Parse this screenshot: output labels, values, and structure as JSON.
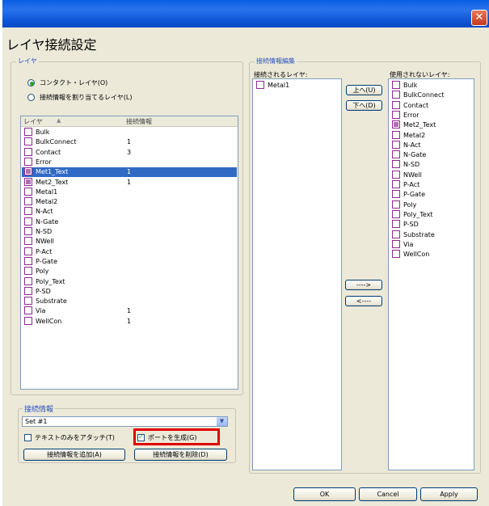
{
  "window": {
    "close_glyph": "✕",
    "title": "レイヤ接続設定"
  },
  "layer_group": {
    "label": "レイヤ",
    "radio_contact_layer": "コンタクト・レイヤ(O)",
    "radio_assign_connection": "接続情報を割り当てるレイヤ(L)",
    "col_layer": "レイヤ",
    "col_sort_glyph": "▲",
    "col_connection": "接続情報",
    "rows": [
      {
        "name": "Bulk",
        "value": "",
        "checked": false,
        "selected": false
      },
      {
        "name": "BulkConnect",
        "value": "1",
        "checked": false,
        "selected": false
      },
      {
        "name": "Contact",
        "value": "3",
        "checked": false,
        "selected": false
      },
      {
        "name": "Error",
        "value": "",
        "checked": false,
        "selected": false
      },
      {
        "name": "Met1_Text",
        "value": "1",
        "checked": true,
        "selected": true
      },
      {
        "name": "Met2_Text",
        "value": "1",
        "checked": true,
        "selected": false
      },
      {
        "name": "Metal1",
        "value": "",
        "checked": false,
        "selected": false
      },
      {
        "name": "Metal2",
        "value": "",
        "checked": false,
        "selected": false
      },
      {
        "name": "N-Act",
        "value": "",
        "checked": false,
        "selected": false
      },
      {
        "name": "N-Gate",
        "value": "",
        "checked": false,
        "selected": false
      },
      {
        "name": "N-SD",
        "value": "",
        "checked": false,
        "selected": false
      },
      {
        "name": "NWell",
        "value": "",
        "checked": false,
        "selected": false
      },
      {
        "name": "P-Act",
        "value": "",
        "checked": false,
        "selected": false
      },
      {
        "name": "P-Gate",
        "value": "",
        "checked": false,
        "selected": false
      },
      {
        "name": "Poly",
        "value": "",
        "checked": false,
        "selected": false
      },
      {
        "name": "Poly_Text",
        "value": "",
        "checked": false,
        "selected": false
      },
      {
        "name": "P-SD",
        "value": "",
        "checked": false,
        "selected": false
      },
      {
        "name": "Substrate",
        "value": "",
        "checked": false,
        "selected": false
      },
      {
        "name": "Via",
        "value": "1",
        "checked": false,
        "selected": false
      },
      {
        "name": "WellCon",
        "value": "1",
        "checked": false,
        "selected": false
      }
    ]
  },
  "conn_group": {
    "label": "接続情報",
    "select_value": "Set #1",
    "attach_text_only": "テキストのみをアタッチ(T)",
    "generate_port": "ポートを生成(G)",
    "add_button": "接続情報を追加(A)",
    "delete_button": "接続情報を削除(D)"
  },
  "edit_group": {
    "label": "接続情報編集",
    "connected_label": "接続されるレイヤ:",
    "unused_label": "使用されないレイヤ:",
    "connected": [
      {
        "name": "Metal1",
        "checked": false
      }
    ],
    "unused": [
      {
        "name": "Bulk",
        "checked": false
      },
      {
        "name": "BulkConnect",
        "checked": false
      },
      {
        "name": "Contact",
        "checked": false
      },
      {
        "name": "Error",
        "checked": false
      },
      {
        "name": "Met2_Text",
        "checked": true
      },
      {
        "name": "Metal2",
        "checked": false
      },
      {
        "name": "N-Act",
        "checked": false
      },
      {
        "name": "N-Gate",
        "checked": false
      },
      {
        "name": "N-SD",
        "checked": false
      },
      {
        "name": "NWell",
        "checked": false
      },
      {
        "name": "P-Act",
        "checked": false
      },
      {
        "name": "P-Gate",
        "checked": false
      },
      {
        "name": "Poly",
        "checked": false
      },
      {
        "name": "Poly_Text",
        "checked": false
      },
      {
        "name": "P-SD",
        "checked": false
      },
      {
        "name": "Substrate",
        "checked": false
      },
      {
        "name": "Via",
        "checked": false
      },
      {
        "name": "WellCon",
        "checked": false
      }
    ],
    "up_button": "上へ(U)",
    "down_button": "下へ(D)",
    "move_right_button": "---->",
    "move_left_button": "<----"
  },
  "footer": {
    "ok": "OK",
    "cancel": "Cancel",
    "apply": "Apply"
  },
  "colors": {
    "highlight_box": "#e00000",
    "selection": "#316ac5",
    "titlebar": "#0a5ee0"
  }
}
